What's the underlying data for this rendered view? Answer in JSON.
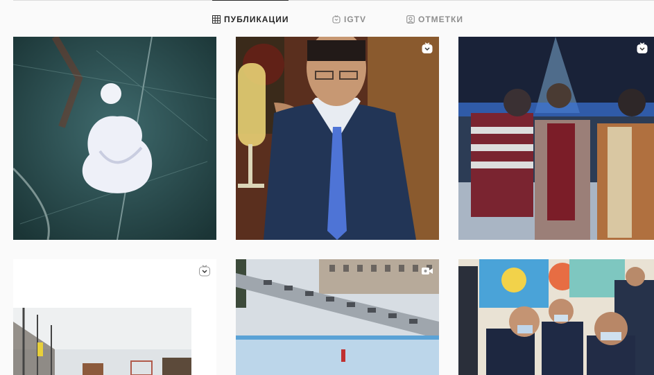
{
  "tabs": [
    {
      "label": "ПУБЛИКАЦИИ",
      "icon": "grid-icon",
      "active": true
    },
    {
      "label": "IGTV",
      "icon": "igtv-icon",
      "active": false
    },
    {
      "label": "ОТМЕТКИ",
      "icon": "tagged-icon",
      "active": false
    }
  ],
  "posts": [
    {
      "subject": "ice-figure-photo",
      "badge": null
    },
    {
      "subject": "man-with-champagne-photo",
      "badge": "igtv-icon"
    },
    {
      "subject": "people-at-festive-night-photo",
      "badge": "igtv-icon"
    },
    {
      "subject": "sports-court-photo",
      "badge": "igtv-icon"
    },
    {
      "subject": "winter-city-ice-rink-photo",
      "badge": "video-camera-icon"
    },
    {
      "subject": "meeting-people-in-masks-photo",
      "badge": null
    }
  ],
  "colors": {
    "active_tab": "#262626",
    "inactive_tab": "#8e8e8e",
    "background": "#fafafa"
  }
}
